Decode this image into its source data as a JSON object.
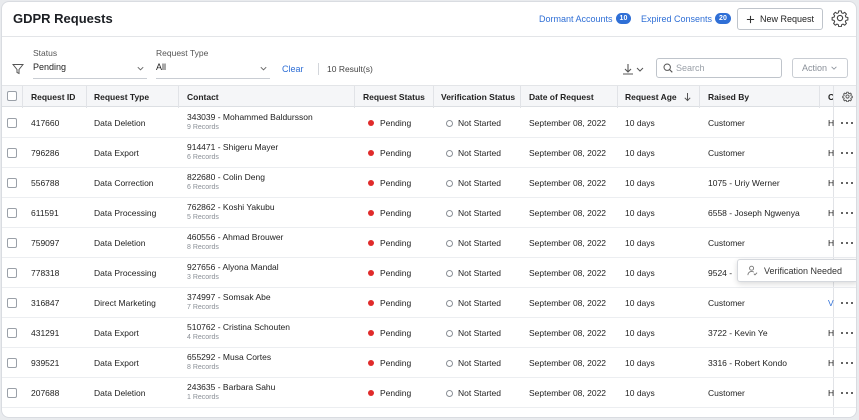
{
  "header": {
    "title": "GDPR Requests",
    "dormant_label": "Dormant Accounts",
    "dormant_count": "10",
    "expired_label": "Expired Consents",
    "expired_count": "20",
    "new_request_label": "New Request"
  },
  "filters": {
    "status_label": "Status",
    "status_value": "Pending",
    "type_label": "Request Type",
    "type_value": "All",
    "clear_label": "Clear",
    "results_text": "10 Result(s)",
    "search_placeholder": "Search",
    "action_label": "Action"
  },
  "table": {
    "columns": [
      "Request ID",
      "Request Type",
      "Contact",
      "Request Status",
      "Verification Status",
      "Date of Request",
      "Request Age",
      "Raised By",
      "C"
    ],
    "rows": [
      {
        "id": "417660",
        "type": "Data Deletion",
        "contact": "343039 - Mohammed Baldursson",
        "records": "9 Records",
        "status": "Pending",
        "verification": "Not Started",
        "date": "September 08, 2022",
        "age": "10 days",
        "raised_by": "Customer",
        "c": "H"
      },
      {
        "id": "796286",
        "type": "Data Export",
        "contact": "914471 - Shigeru Mayer",
        "records": "6 Records",
        "status": "Pending",
        "verification": "Not Started",
        "date": "September 08, 2022",
        "age": "10 days",
        "raised_by": "Customer",
        "c": "H"
      },
      {
        "id": "556788",
        "type": "Data Correction",
        "contact": "822680 - Colin Deng",
        "records": "6 Records",
        "status": "Pending",
        "verification": "Not Started",
        "date": "September 08, 2022",
        "age": "10 days",
        "raised_by": "1075 - Uriy Werner",
        "c": "H"
      },
      {
        "id": "611591",
        "type": "Data Processing",
        "contact": "762862 - Koshi Yakubu",
        "records": "5 Records",
        "status": "Pending",
        "verification": "Not Started",
        "date": "September 08, 2022",
        "age": "10 days",
        "raised_by": "6558 - Joseph Ngwenya",
        "c": "H"
      },
      {
        "id": "759097",
        "type": "Data Deletion",
        "contact": "460556 - Ahmad Brouwer",
        "records": "8 Records",
        "status": "Pending",
        "verification": "Not Started",
        "date": "September 08, 2022",
        "age": "10 days",
        "raised_by": "Customer",
        "c": "H"
      },
      {
        "id": "778318",
        "type": "Data Processing",
        "contact": "927656 - Alyona Mandal",
        "records": "3 Records",
        "status": "Pending",
        "verification": "Not Started",
        "date": "September 08, 2022",
        "age": "10 days",
        "raised_by": "9524 -",
        "c": ""
      },
      {
        "id": "316847",
        "type": "Direct Marketing",
        "contact": "374997 - Somsak Abe",
        "records": "7 Records",
        "status": "Pending",
        "verification": "Not Started",
        "date": "September 08, 2022",
        "age": "10 days",
        "raised_by": "Customer",
        "c": "V"
      },
      {
        "id": "431291",
        "type": "Data Export",
        "contact": "510762 - Cristina Schouten",
        "records": "4 Records",
        "status": "Pending",
        "verification": "Not Started",
        "date": "September 08, 2022",
        "age": "10 days",
        "raised_by": "3722 - Kevin Ye",
        "c": "H"
      },
      {
        "id": "939521",
        "type": "Data Export",
        "contact": "655292 - Musa Cortes",
        "records": "8 Records",
        "status": "Pending",
        "verification": "Not Started",
        "date": "September 08, 2022",
        "age": "10 days",
        "raised_by": "3316 - Robert Kondo",
        "c": "H"
      },
      {
        "id": "207688",
        "type": "Data Deletion",
        "contact": "243635 - Barbara Sahu",
        "records": "1 Records",
        "status": "Pending",
        "verification": "Not Started",
        "date": "September 08, 2022",
        "age": "10 days",
        "raised_by": "Customer",
        "c": "H"
      }
    ]
  },
  "popover": {
    "label": "Verification Needed"
  },
  "colors": {
    "accent": "#2f6fd6",
    "pending_dot": "#e02b2b"
  }
}
